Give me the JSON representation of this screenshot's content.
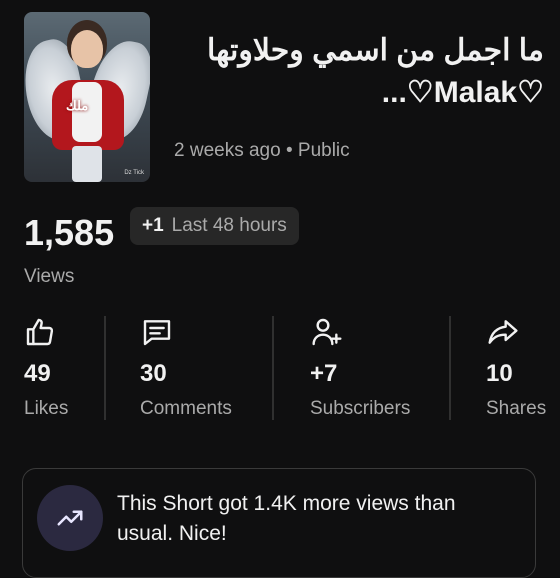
{
  "short": {
    "thumbnail_caption": "ملك",
    "thumbnail_watermark": "Dz Tick",
    "title": "ما اجمل من اسمي وحلاوتها ♡Malak♡...",
    "meta": "2 weeks ago • Public"
  },
  "views": {
    "count": "1,585",
    "delta": "+1",
    "period": "Last 48 hours",
    "label": "Views"
  },
  "stats": [
    {
      "icon": "thumbs-up-icon",
      "value": "49",
      "label": "Likes"
    },
    {
      "icon": "comments-icon",
      "value": "30",
      "label": "Comments"
    },
    {
      "icon": "add-person-icon",
      "value": "+7",
      "label": "Subscribers"
    },
    {
      "icon": "share-icon",
      "value": "10",
      "label": "Shares"
    }
  ],
  "insight": {
    "icon": "trending-up-icon",
    "message": "This Short got 1.4K more views than usual. Nice!"
  },
  "colors": {
    "background": "#0f0f10",
    "secondary_text": "#aaaaaa",
    "pill_bg": "#272727",
    "insight_icon_bg": "#2b2940"
  }
}
